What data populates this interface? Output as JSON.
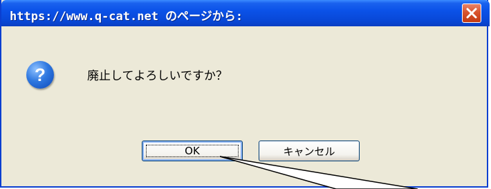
{
  "dialog": {
    "title": "https://www.q-cat.net のページから:",
    "message": "廃止してよろしいですか？",
    "icon": "question-icon",
    "close_icon": "close-icon",
    "buttons": {
      "ok_label": "OK",
      "cancel_label": "キャンセル"
    }
  },
  "colors": {
    "titlebar": "#0b52e8",
    "dialog_bg": "#ece9d8",
    "close_button": "#d9542e",
    "icon": "#2f78e0"
  }
}
